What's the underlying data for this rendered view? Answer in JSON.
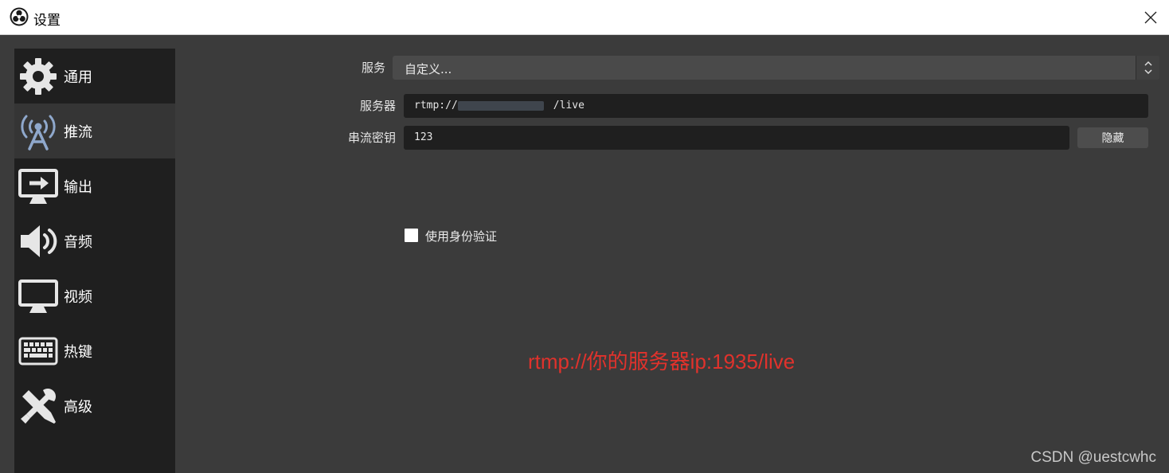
{
  "window": {
    "title": "设置",
    "icon": "obs-logo-icon"
  },
  "sidebar": {
    "items": [
      {
        "label": "通用",
        "icon": "gear-icon",
        "active": false
      },
      {
        "label": "推流",
        "icon": "broadcast-antenna-icon",
        "active": true
      },
      {
        "label": "输出",
        "icon": "monitor-output-icon",
        "active": false
      },
      {
        "label": "音频",
        "icon": "speaker-icon",
        "active": false
      },
      {
        "label": "视频",
        "icon": "monitor-icon",
        "active": false
      },
      {
        "label": "热键",
        "icon": "keyboard-icon",
        "active": false
      },
      {
        "label": "高级",
        "icon": "wrench-screwdriver-icon",
        "active": false
      }
    ]
  },
  "form": {
    "service": {
      "label": "服务",
      "value": "自定义..."
    },
    "server": {
      "label": "服务器",
      "value_prefix": "rtmp://",
      "value_suffix": "/live"
    },
    "stream_key": {
      "label": "串流密钥",
      "value": "123",
      "button_label": "隐藏"
    },
    "use_auth": {
      "label": "使用身份验证",
      "checked": false
    }
  },
  "annotation": "rtmp://你的服务器ip:1935/live",
  "watermark": "CSDN @uestcwhc",
  "colors": {
    "annotation": "#e0322c",
    "sidebar_bg": "#1f1f1f",
    "panel_bg": "#3b3b3b"
  }
}
